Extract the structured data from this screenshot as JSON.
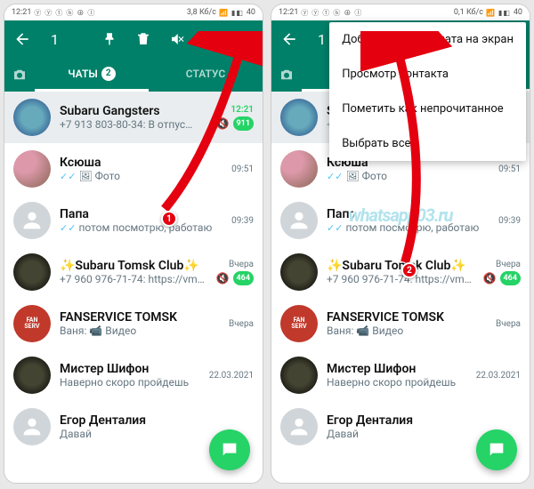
{
  "status": {
    "time": "12:21",
    "net_left": "3,8 Кб/с",
    "net_right": "0,1 Кб/с",
    "batt": "40"
  },
  "appbar": {
    "selected_count": "1"
  },
  "tabs": {
    "camera": "",
    "chats": "ЧАТЫ",
    "chats_badge": "2",
    "status": "СТАТУС",
    "calls": ""
  },
  "menu": {
    "item1": "Добавить иконку чата на экран",
    "item2": "Просмотр контакта",
    "item3": "Пометить как непрочитанное",
    "item4": "Выбрать все"
  },
  "chats": {
    "c0": {
      "title": "Subaru Gangsters",
      "sub": "+7 913 803-80-34: В отпус…",
      "time": "12:21",
      "badge": "911"
    },
    "c1": {
      "title": "Ксюша",
      "sub": "Фото",
      "time": "09:51"
    },
    "c2": {
      "title": "Папа",
      "sub": "потом посмотрю, работаю",
      "time": "09:39"
    },
    "c3": {
      "title": "✨Subaru Tomsk Club✨",
      "sub": "+7 960 976-71-74: https://vm…",
      "time": "Вчера",
      "badge": "464"
    },
    "c4": {
      "title": "FANSERVICE TOMSK",
      "sub": "Ваня: 📹 Видео",
      "time": "Вчера"
    },
    "c5": {
      "title": "Мистер Шифон",
      "sub": "Наверно скоро пройдешь",
      "time": "22.03.2021"
    },
    "c6": {
      "title": "Егор Денталия",
      "sub": "Давай",
      "time": ""
    }
  },
  "steps": {
    "s1": "1",
    "s2": "2"
  },
  "watermark": "whatsapp03.ru"
}
